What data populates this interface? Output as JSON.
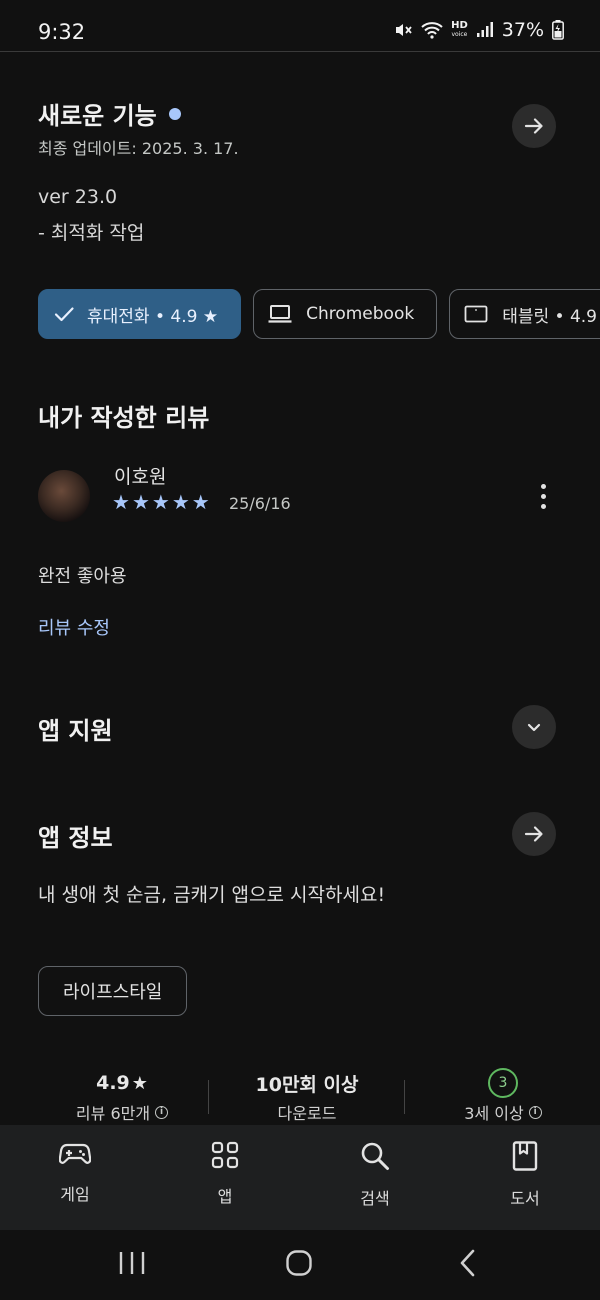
{
  "status_bar": {
    "time": "9:32",
    "battery": "37%",
    "hd_top": "HD",
    "hd_bottom": "voice"
  },
  "whats_new": {
    "title": "새로운 기능",
    "updated": "최종 업데이트: 2025. 3. 17.",
    "notes": [
      "ver 23.0",
      "- 최적화 작업"
    ]
  },
  "device_chips": [
    {
      "label": "휴대전화 • 4.9 ★",
      "icon": "check-icon",
      "selected": true
    },
    {
      "label": "Chromebook",
      "icon": "laptop-icon",
      "selected": false
    },
    {
      "label": "태블릿 • 4.9",
      "icon": "tablet-icon",
      "selected": false
    }
  ],
  "my_review": {
    "heading": "내가 작성한 리뷰",
    "name": "이호원",
    "stars": 5,
    "date": "25/6/16",
    "text": "완전 좋아용",
    "edit_label": "리뷰 수정"
  },
  "app_support": {
    "heading": "앱 지원"
  },
  "app_info": {
    "heading": "앱 정보",
    "description": "내 생애 첫 순금, 금캐기 앱으로 시작하세요!",
    "category": "라이프스타일"
  },
  "stats": {
    "rating": "4.9",
    "rating_star": "★",
    "reviews_label": "리뷰 6만개",
    "downloads": "10만회 이상",
    "downloads_label": "다운로드",
    "age_badge": "3",
    "age_label": "3세 이상"
  },
  "bottom_nav": [
    {
      "label": "게임",
      "icon": "gamepad-icon"
    },
    {
      "label": "앱",
      "icon": "apps-grid-icon"
    },
    {
      "label": "검색",
      "icon": "search-icon"
    },
    {
      "label": "도서",
      "icon": "book-icon"
    }
  ],
  "colors": {
    "background": "#111111",
    "accent": "#a8c7fa",
    "selected_chip": "#2f5f87",
    "age_green": "#5fb860"
  }
}
